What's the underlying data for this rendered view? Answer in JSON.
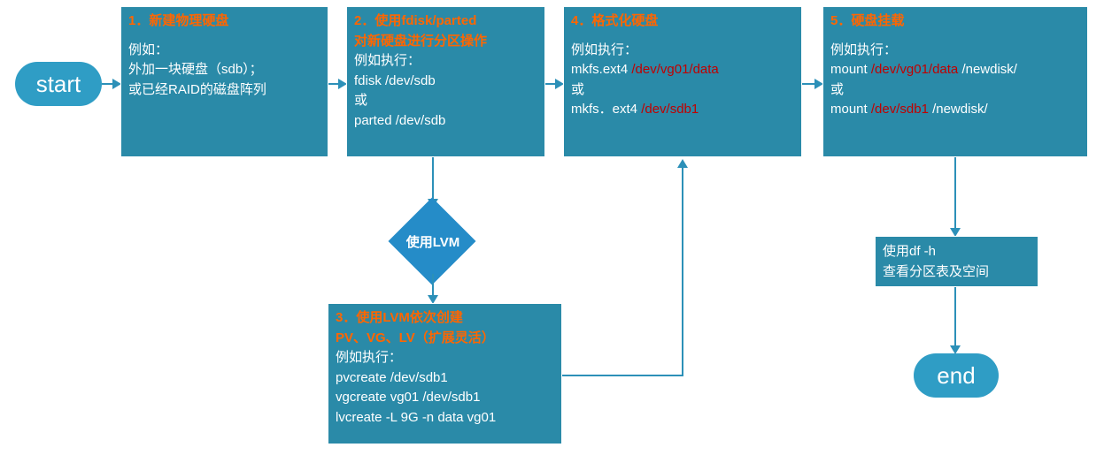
{
  "start": "start",
  "end": "end",
  "box1": {
    "title": "1．新建物理硬盘",
    "body_l1": "例如：",
    "body_l2": "外加一块硬盘（sdb）；",
    "body_l3": "或已经RAID的磁盘阵列"
  },
  "box2": {
    "title_l1": "2．使用fdisk/parted",
    "title_l2": "对新硬盘进行分区操作",
    "body_l1": "例如执行：",
    "body_l2": "fdisk  /dev/sdb",
    "body_l3": "或",
    "body_l4": "parted  /dev/sdb"
  },
  "diamond": "使用LVM",
  "box3": {
    "title_l1": "3．使用LVM依次创建",
    "title_l2": "PV、VG、LV（扩展灵活）",
    "body_l1": "例如执行：",
    "body_l2": "pvcreate /dev/sdb1",
    "body_l3": "vgcreate vg01 /dev/sdb1",
    "body_l4": "lvcreate -L 9G -n data vg01"
  },
  "box4": {
    "title": "4．格式化硬盘",
    "body_l1": "例如执行：",
    "body_l2a": "mkfs.ext4 ",
    "body_l2b": "/dev/vg01/data",
    "body_l3": "或",
    "body_l4a": "mkfs．ext4 ",
    "body_l4b": "/dev/sdb1"
  },
  "box5": {
    "title": "5．硬盘挂载",
    "body_l1": "例如执行：",
    "body_l2a": "mount ",
    "body_l2b": "/dev/vg01/data",
    "body_l2c": " /newdisk/",
    "body_l3": "或",
    "body_l4a": "mount ",
    "body_l4b": "/dev/sdb1 ",
    "body_l4c": " /newdisk/"
  },
  "box6": {
    "l1": "使用df  -h",
    "l2": "查看分区表及空间"
  }
}
